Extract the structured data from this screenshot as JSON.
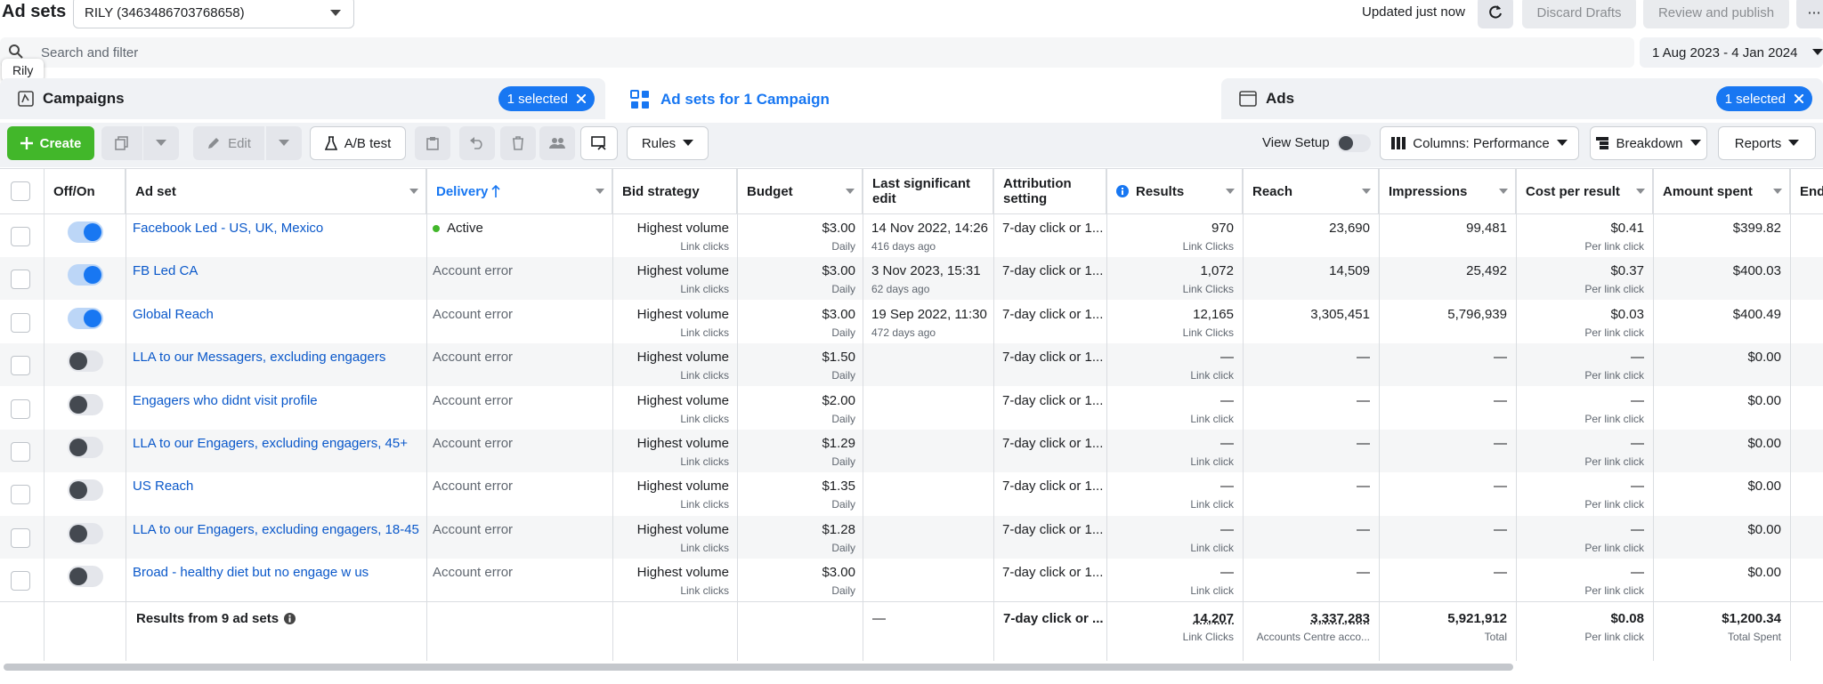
{
  "header": {
    "title": "Ad sets",
    "account": "RILY (3463486703768658)",
    "updated": "Updated just now",
    "discard": "Discard Drafts",
    "review": "Review and publish",
    "more": "⋯"
  },
  "search": {
    "placeholder": "Search and filter",
    "tooltip": "Rily",
    "date_range": "1 Aug 2023 - 4 Jan 2024"
  },
  "panels": {
    "campaigns": "Campaigns",
    "campaigns_selected": "1 selected",
    "adsets": "Ad sets for 1 Campaign",
    "ads": "Ads",
    "ads_selected": "1 selected"
  },
  "toolbar": {
    "create": "Create",
    "edit": "Edit",
    "ab_test": "A/B test",
    "rules": "Rules",
    "view_setup": "View Setup",
    "columns": "Columns: Performance",
    "breakdown": "Breakdown",
    "reports": "Reports"
  },
  "columns": {
    "offon": "Off/On",
    "adset": "Ad set",
    "delivery": "Delivery",
    "bid": "Bid strategy",
    "budget": "Budget",
    "last_edit": "Last significant edit",
    "attribution": "Attribution setting",
    "results": "Results",
    "reach": "Reach",
    "impressions": "Impressions",
    "cpr": "Cost per result",
    "spent": "Amount spent",
    "ends": "Ends"
  },
  "rows": [
    {
      "on": true,
      "name": "Facebook Led - US, UK, Mexico",
      "delivery": "Active",
      "bid": "Highest volume",
      "bid_sub": "Link clicks",
      "budget": "$3.00",
      "budget_sub": "Daily",
      "edit": "14 Nov 2022, 14:26",
      "edit_sub": "416 days ago",
      "attr": "7-day click or 1...",
      "results": "970",
      "results_sub": "Link Clicks",
      "reach": "23,690",
      "impr": "99,481",
      "cpr": "$0.41",
      "cpr_sub": "Per link click",
      "spent": "$399.82"
    },
    {
      "on": true,
      "name": "FB Led CA",
      "delivery": "Account error",
      "bid": "Highest volume",
      "bid_sub": "Link clicks",
      "budget": "$3.00",
      "budget_sub": "Daily",
      "edit": "3 Nov 2023, 15:31",
      "edit_sub": "62 days ago",
      "attr": "7-day click or 1...",
      "results": "1,072",
      "results_sub": "Link Clicks",
      "reach": "14,509",
      "impr": "25,492",
      "cpr": "$0.37",
      "cpr_sub": "Per link click",
      "spent": "$400.03"
    },
    {
      "on": true,
      "name": "Global Reach",
      "delivery": "Account error",
      "bid": "Highest volume",
      "bid_sub": "Link clicks",
      "budget": "$3.00",
      "budget_sub": "Daily",
      "edit": "19 Sep 2022, 11:30",
      "edit_sub": "472 days ago",
      "attr": "7-day click or 1...",
      "results": "12,165",
      "results_sub": "Link Clicks",
      "reach": "3,305,451",
      "impr": "5,796,939",
      "cpr": "$0.03",
      "cpr_sub": "Per link click",
      "spent": "$400.49"
    },
    {
      "on": false,
      "name": "LLA to our Messagers, excluding engagers",
      "delivery": "Account error",
      "bid": "Highest volume",
      "bid_sub": "Link clicks",
      "budget": "$1.50",
      "budget_sub": "Daily",
      "edit": "",
      "edit_sub": "",
      "attr": "7-day click or 1...",
      "results": "—",
      "results_sub": "Link click",
      "reach": "—",
      "impr": "—",
      "cpr": "—",
      "cpr_sub": "Per link click",
      "spent": "$0.00"
    },
    {
      "on": false,
      "name": "Engagers who didnt visit profile",
      "delivery": "Account error",
      "bid": "Highest volume",
      "bid_sub": "Link clicks",
      "budget": "$2.00",
      "budget_sub": "Daily",
      "edit": "",
      "edit_sub": "",
      "attr": "7-day click or 1...",
      "results": "—",
      "results_sub": "Link click",
      "reach": "—",
      "impr": "—",
      "cpr": "—",
      "cpr_sub": "Per link click",
      "spent": "$0.00"
    },
    {
      "on": false,
      "name": "LLA to our Engagers, excluding engagers, 45+",
      "delivery": "Account error",
      "bid": "Highest volume",
      "bid_sub": "Link clicks",
      "budget": "$1.29",
      "budget_sub": "Daily",
      "edit": "",
      "edit_sub": "",
      "attr": "7-day click or 1...",
      "results": "—",
      "results_sub": "Link click",
      "reach": "—",
      "impr": "—",
      "cpr": "—",
      "cpr_sub": "Per link click",
      "spent": "$0.00"
    },
    {
      "on": false,
      "name": "US Reach",
      "delivery": "Account error",
      "bid": "Highest volume",
      "bid_sub": "Link clicks",
      "budget": "$1.35",
      "budget_sub": "Daily",
      "edit": "",
      "edit_sub": "",
      "attr": "7-day click or 1...",
      "results": "—",
      "results_sub": "Link click",
      "reach": "—",
      "impr": "—",
      "cpr": "—",
      "cpr_sub": "Per link click",
      "spent": "$0.00"
    },
    {
      "on": false,
      "name": "LLA to our Engagers, excluding engagers, 18-45",
      "delivery": "Account error",
      "bid": "Highest volume",
      "bid_sub": "Link clicks",
      "budget": "$1.28",
      "budget_sub": "Daily",
      "edit": "",
      "edit_sub": "",
      "attr": "7-day click or 1...",
      "results": "—",
      "results_sub": "Link click",
      "reach": "—",
      "impr": "—",
      "cpr": "—",
      "cpr_sub": "Per link click",
      "spent": "$0.00"
    },
    {
      "on": false,
      "name": "Broad - healthy diet but no engage w us",
      "delivery": "Account error",
      "bid": "Highest volume",
      "bid_sub": "Link clicks",
      "budget": "$3.00",
      "budget_sub": "Daily",
      "edit": "",
      "edit_sub": "",
      "attr": "7-day click or 1...",
      "results": "—",
      "results_sub": "Link click",
      "reach": "—",
      "impr": "—",
      "cpr": "—",
      "cpr_sub": "Per link click",
      "spent": "$0.00"
    }
  ],
  "totals": {
    "label": "Results from 9 ad sets",
    "edit": "—",
    "attr": "7-day click or ...",
    "results": "14,207",
    "results_sub": "Link Clicks",
    "reach": "3,337,283",
    "reach_sub": "Accounts Centre acco...",
    "impr": "5,921,912",
    "impr_sub": "Total",
    "cpr": "$0.08",
    "cpr_sub": "Per link click",
    "spent": "$1,200.34",
    "spent_sub": "Total Spent"
  },
  "colors": {
    "accent": "#1877f2",
    "create": "#42b72a",
    "active": "#42b72a",
    "link": "#0a58ca"
  }
}
